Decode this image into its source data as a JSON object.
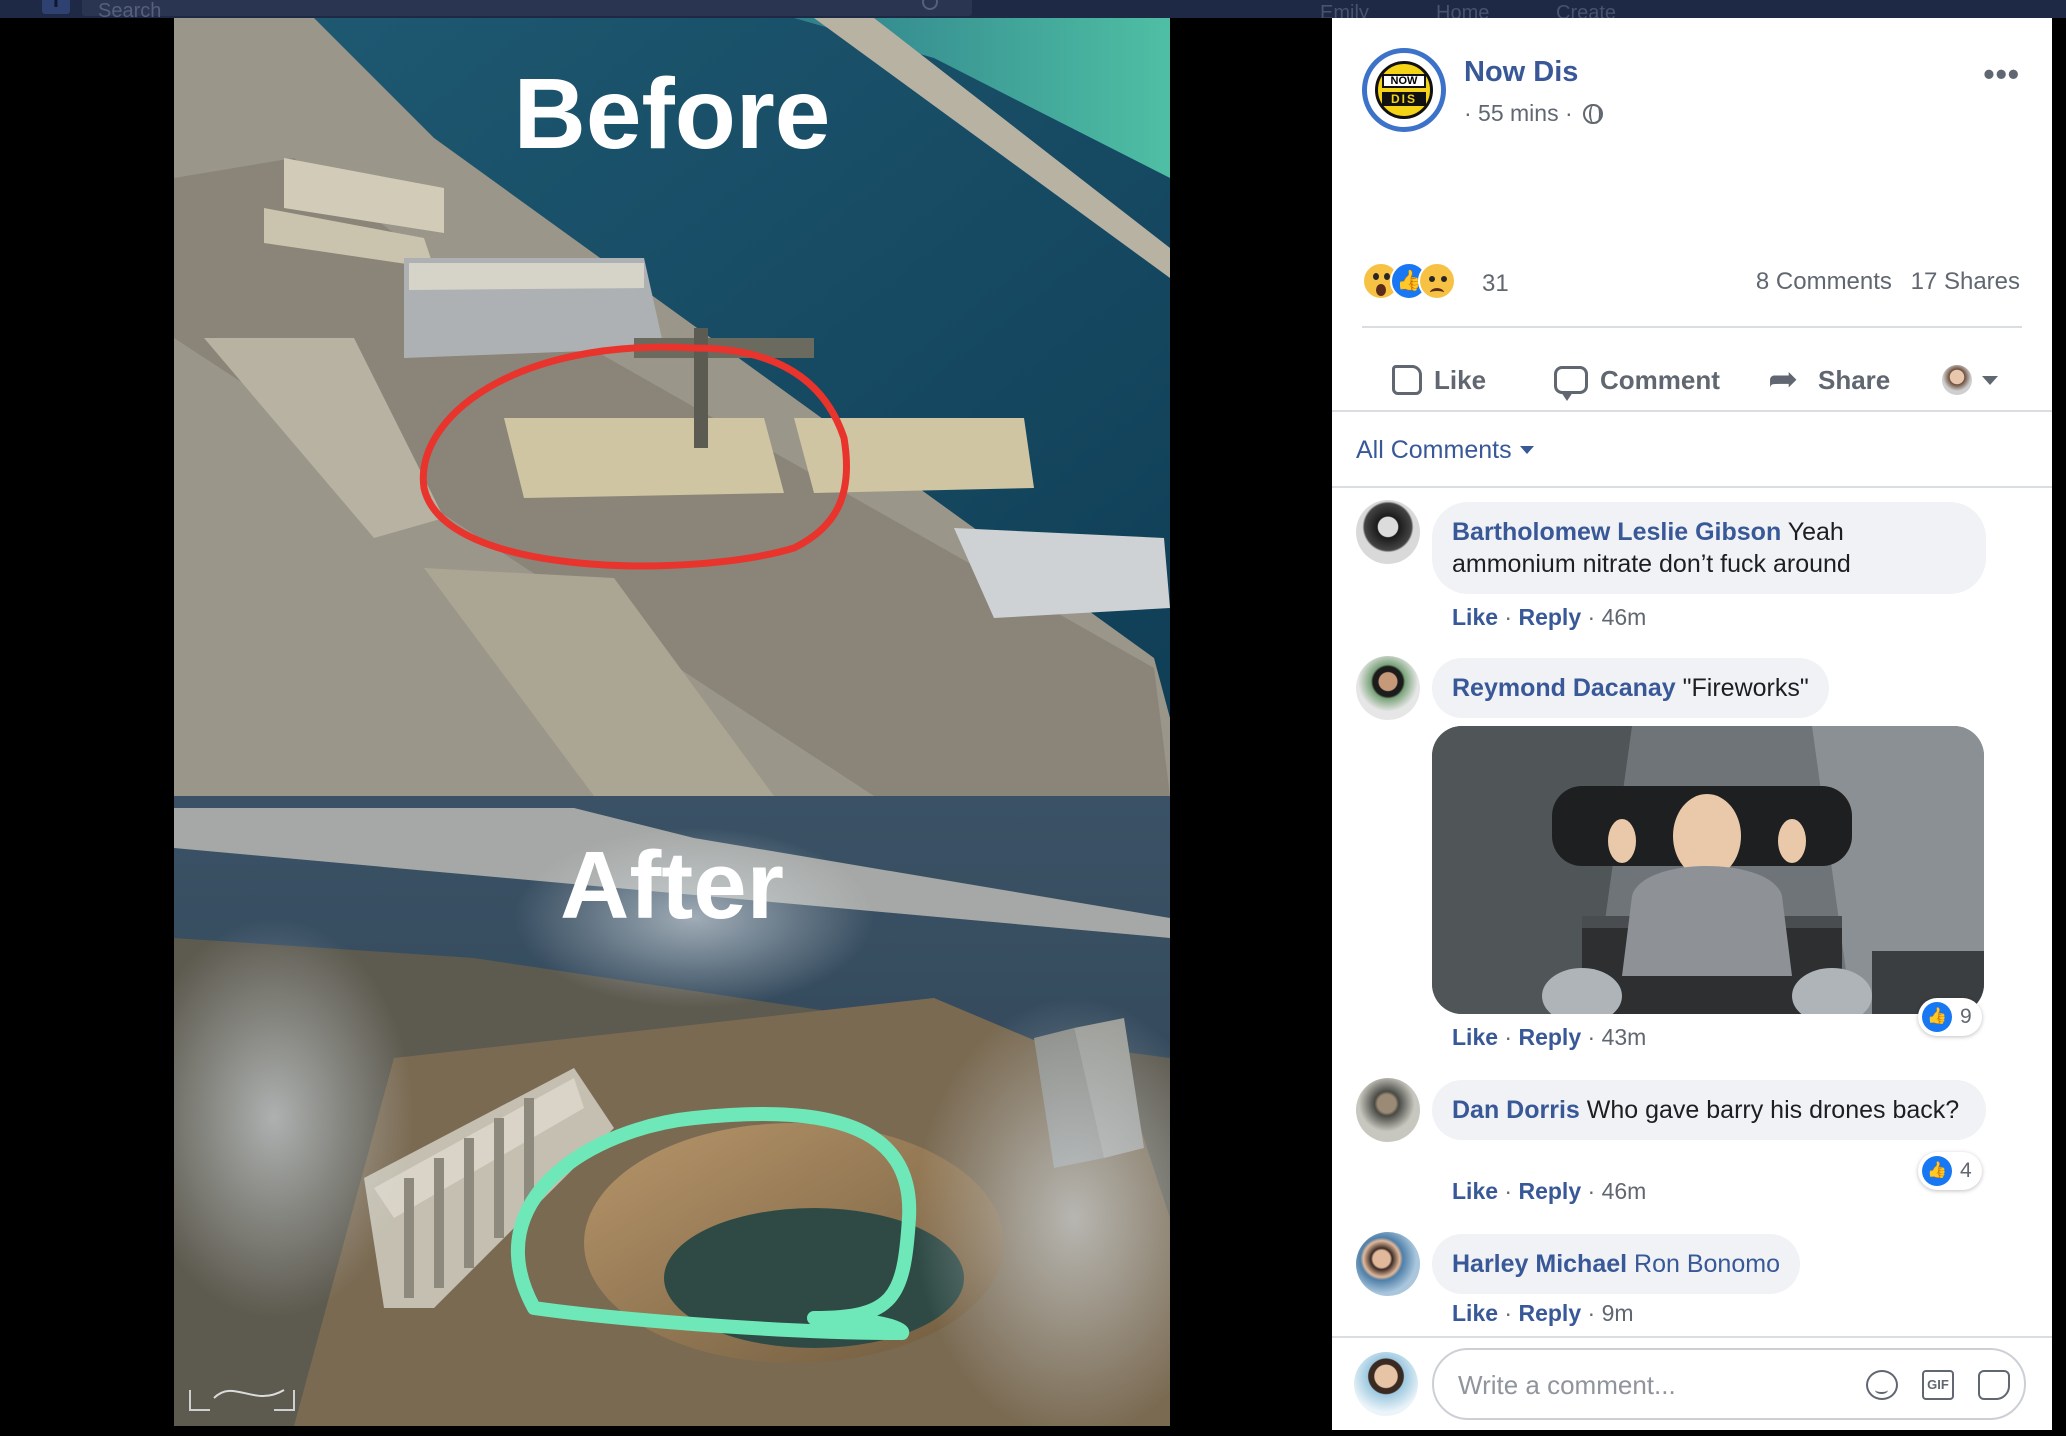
{
  "topbar": {
    "search_placeholder": "Search",
    "nav_items": [
      "Emily",
      "Home",
      "Create"
    ]
  },
  "photo": {
    "before_label": "Before",
    "after_label": "After",
    "before_circle_color": "#e8342c",
    "after_circle_color": "#6ee8b8"
  },
  "post": {
    "page_name": "Now Dis",
    "logo_now": "NOW",
    "logo_dis": "DIS",
    "time": "· 55 mins ·",
    "reaction_count": "31",
    "comments_count": "8 Comments",
    "shares_count": "17 Shares",
    "actions": {
      "like": "Like",
      "comment": "Comment",
      "share": "Share"
    },
    "all_comments_label": "All Comments"
  },
  "comments": [
    {
      "author": "Bartholomew Leslie Gibson",
      "text": "Yeah ammonium nitrate don’t fuck around",
      "like": "Like",
      "reply": "Reply",
      "time": "46m"
    },
    {
      "author": "Reymond Dacanay",
      "text": "\"Fireworks\"",
      "like": "Like",
      "reply": "Reply",
      "time": "43m",
      "likes": "9"
    },
    {
      "author": "Dan Dorris",
      "text": "Who gave barry his drones back?",
      "like": "Like",
      "reply": "Reply",
      "time": "46m",
      "likes": "4"
    },
    {
      "author": "Harley Michael",
      "mention": "Ron Bonomo",
      "like": "Like",
      "reply": "Reply",
      "time": "9m"
    }
  ],
  "composer": {
    "placeholder": "Write a comment...",
    "gif_label": "GIF"
  },
  "colors": {
    "link_blue": "#385898",
    "like_blue": "#1877f2",
    "meta_gray": "#606770"
  }
}
